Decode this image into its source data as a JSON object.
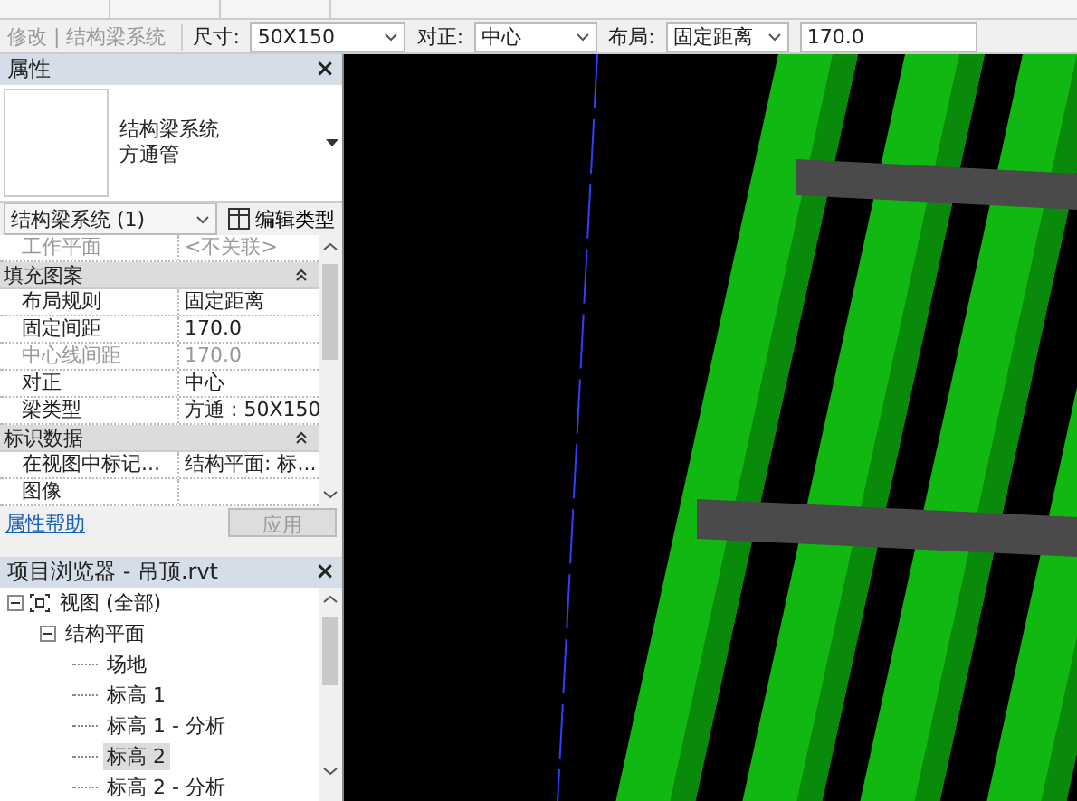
{
  "options_bar": {
    "context": "修改 | 结构梁系统",
    "fields": [
      {
        "kind": "dropdown",
        "label": "尺寸:",
        "value": "50X150"
      },
      {
        "kind": "dropdown",
        "label": "对正:",
        "value": "中心"
      },
      {
        "kind": "dropdown",
        "label": "布局:",
        "value": "固定距离"
      },
      {
        "kind": "text",
        "value": "170.0"
      }
    ]
  },
  "properties": {
    "title": "属性",
    "close": "×",
    "type_name": "结构梁系统",
    "type_sub": "方通管",
    "instance": "结构梁系统 (1)",
    "edit_type": "编辑类型",
    "rows": [
      {
        "kind": "param",
        "name": "工作平面",
        "value": "<不关联>",
        "disabled": true
      },
      {
        "kind": "group",
        "name": "填充图案"
      },
      {
        "kind": "param",
        "name": "布局规则",
        "value": "固定距离",
        "disabled": false
      },
      {
        "kind": "param",
        "name": "固定间距",
        "value": "170.0",
        "disabled": false
      },
      {
        "kind": "param",
        "name": "中心线间距",
        "value": "170.0",
        "disabled": true
      },
      {
        "kind": "param",
        "name": "对正",
        "value": "中心",
        "disabled": false
      },
      {
        "kind": "param",
        "name": "梁类型",
        "value": "方通 : 50X150",
        "disabled": false
      },
      {
        "kind": "group",
        "name": "标识数据"
      },
      {
        "kind": "param",
        "name": "在视图中标记...",
        "value": "结构平面: 标...",
        "disabled": false
      },
      {
        "kind": "param",
        "name": "图像",
        "disabled": false
      }
    ],
    "help_link": "属性帮助",
    "apply": {
      "label": "应用",
      "disabled": true
    }
  },
  "project_browser": {
    "title": "项目浏览器 - 吊顶.rvt",
    "close": "×",
    "tree": [
      {
        "label": "视图 (全部)",
        "expanded": true,
        "selected": false,
        "children": [
          {
            "label": "结构平面",
            "expanded": true,
            "selected": false,
            "children": [
              {
                "label": "场地",
                "selected": false
              },
              {
                "label": "标高 1",
                "selected": false
              },
              {
                "label": "标高 1 - 分析",
                "selected": false
              },
              {
                "label": "标高 2",
                "selected": true
              },
              {
                "label": "标高 2 - 分析",
                "selected": false
              }
            ]
          }
        ]
      }
    ]
  }
}
